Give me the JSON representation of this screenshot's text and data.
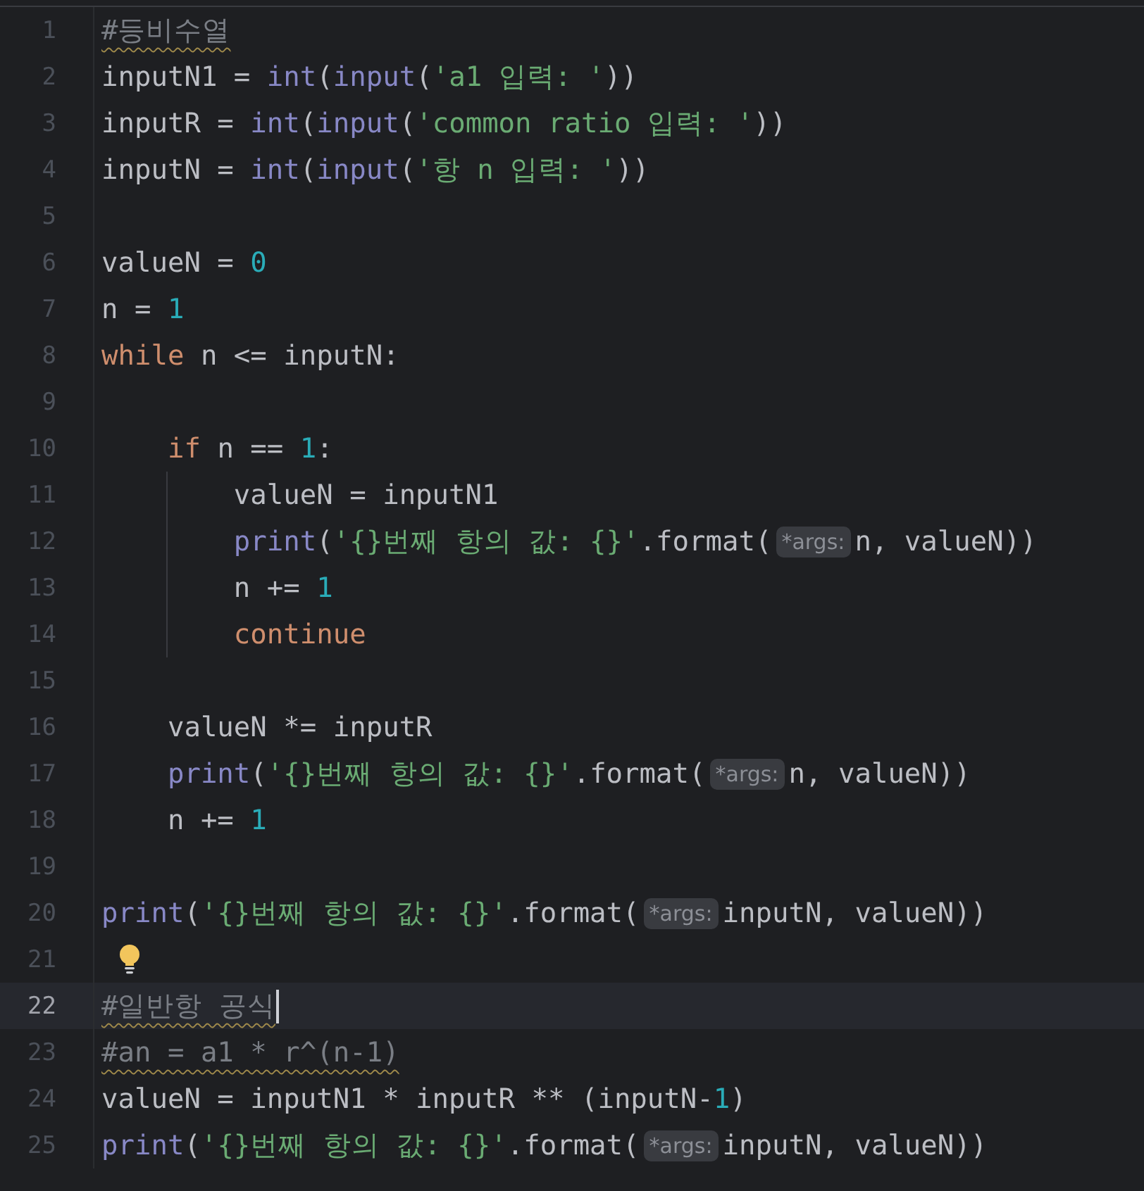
{
  "lines": [
    {
      "number": "1",
      "current": false,
      "tokens": [
        {
          "kind": "comment",
          "text": "#등비수열"
        }
      ]
    },
    {
      "number": "2",
      "current": false,
      "tokens": [
        {
          "kind": "plain",
          "text": "inputN1 = "
        },
        {
          "kind": "builtin",
          "text": "int"
        },
        {
          "kind": "plain",
          "text": "("
        },
        {
          "kind": "builtin",
          "text": "input"
        },
        {
          "kind": "plain",
          "text": "("
        },
        {
          "kind": "str",
          "text": "'a1 입력: '"
        },
        {
          "kind": "plain",
          "text": "))"
        }
      ]
    },
    {
      "number": "3",
      "current": false,
      "tokens": [
        {
          "kind": "plain",
          "text": "inputR = "
        },
        {
          "kind": "builtin",
          "text": "int"
        },
        {
          "kind": "plain",
          "text": "("
        },
        {
          "kind": "builtin",
          "text": "input"
        },
        {
          "kind": "plain",
          "text": "("
        },
        {
          "kind": "str",
          "text": "'common ratio 입력: '"
        },
        {
          "kind": "plain",
          "text": "))"
        }
      ]
    },
    {
      "number": "4",
      "current": false,
      "tokens": [
        {
          "kind": "plain",
          "text": "inputN = "
        },
        {
          "kind": "builtin",
          "text": "int"
        },
        {
          "kind": "plain",
          "text": "("
        },
        {
          "kind": "builtin",
          "text": "input"
        },
        {
          "kind": "plain",
          "text": "("
        },
        {
          "kind": "str",
          "text": "'항 n 입력: '"
        },
        {
          "kind": "plain",
          "text": "))"
        }
      ]
    },
    {
      "number": "5",
      "current": false
    },
    {
      "number": "6",
      "current": false,
      "tokens": [
        {
          "kind": "plain",
          "text": "valueN = "
        },
        {
          "kind": "num",
          "text": "0"
        }
      ]
    },
    {
      "number": "7",
      "current": false,
      "tokens": [
        {
          "kind": "plain",
          "text": "n = "
        },
        {
          "kind": "num",
          "text": "1"
        }
      ]
    },
    {
      "number": "8",
      "current": false,
      "tokens": [
        {
          "kind": "kw",
          "text": "while"
        },
        {
          "kind": "plain",
          "text": " n <= inputN:"
        }
      ]
    },
    {
      "number": "9",
      "current": false
    },
    {
      "number": "10",
      "current": false,
      "tokens": [
        {
          "kind": "kw",
          "text": "    if"
        },
        {
          "kind": "plain",
          "text": " n == "
        },
        {
          "kind": "num",
          "text": "1"
        },
        {
          "kind": "plain",
          "text": ":"
        }
      ]
    },
    {
      "number": "11",
      "current": false,
      "indent_guide": true,
      "tokens": [
        {
          "kind": "plain",
          "text": "        valueN = inputN1"
        }
      ]
    },
    {
      "number": "12",
      "current": false,
      "indent_guide": true,
      "tokens": [
        {
          "kind": "builtin",
          "text": "        print"
        },
        {
          "kind": "plain",
          "text": "("
        },
        {
          "kind": "str",
          "text": "'{}번째 항의 값: {}'"
        },
        {
          "kind": "plain",
          "text": ".format("
        },
        {
          "kind": "hint",
          "text": "*args:"
        },
        {
          "kind": "plain",
          "text": "n, valueN))"
        }
      ]
    },
    {
      "number": "13",
      "current": false,
      "indent_guide": true,
      "tokens": [
        {
          "kind": "plain",
          "text": "        n += "
        },
        {
          "kind": "num",
          "text": "1"
        }
      ]
    },
    {
      "number": "14",
      "current": false,
      "indent_guide": true,
      "tokens": [
        {
          "kind": "kw",
          "text": "        continue"
        }
      ]
    },
    {
      "number": "15",
      "current": false
    },
    {
      "number": "16",
      "current": false,
      "tokens": [
        {
          "kind": "plain",
          "text": "    valueN *= inputR"
        }
      ]
    },
    {
      "number": "17",
      "current": false,
      "tokens": [
        {
          "kind": "builtin",
          "text": "    print"
        },
        {
          "kind": "plain",
          "text": "("
        },
        {
          "kind": "str",
          "text": "'{}번째 항의 값: {}'"
        },
        {
          "kind": "plain",
          "text": ".format("
        },
        {
          "kind": "hint",
          "text": "*args:"
        },
        {
          "kind": "plain",
          "text": "n, valueN))"
        }
      ]
    },
    {
      "number": "18",
      "current": false,
      "tokens": [
        {
          "kind": "plain",
          "text": "    n += "
        },
        {
          "kind": "num",
          "text": "1"
        }
      ]
    },
    {
      "number": "19",
      "current": false
    },
    {
      "number": "20",
      "current": false,
      "tokens": [
        {
          "kind": "builtin",
          "text": "print"
        },
        {
          "kind": "plain",
          "text": "("
        },
        {
          "kind": "str",
          "text": "'{}번째 항의 값: {}'"
        },
        {
          "kind": "plain",
          "text": ".format("
        },
        {
          "kind": "hint",
          "text": "*args:"
        },
        {
          "kind": "plain",
          "text": "inputN, valueN))"
        }
      ]
    },
    {
      "number": "21",
      "current": false,
      "tokens": [
        {
          "kind": "bulb"
        }
      ]
    },
    {
      "number": "22",
      "current": true,
      "tokens": [
        {
          "kind": "comment",
          "text": "#일반항 공식"
        }
      ]
    },
    {
      "number": "23",
      "current": false,
      "tokens": [
        {
          "kind": "comment",
          "text": "#an = a1 * r^(n-1)"
        }
      ]
    },
    {
      "number": "24",
      "current": false,
      "tokens": [
        {
          "kind": "plain",
          "text": "valueN = inputN1 * inputR ** (inputN-"
        },
        {
          "kind": "num",
          "text": "1"
        },
        {
          "kind": "plain",
          "text": ")"
        }
      ]
    },
    {
      "number": "25",
      "current": false,
      "tokens": [
        {
          "kind": "builtin",
          "text": "print"
        },
        {
          "kind": "plain",
          "text": "("
        },
        {
          "kind": "str",
          "text": "'{}번째 항의 값: {}'"
        },
        {
          "kind": "plain",
          "text": ".format("
        },
        {
          "kind": "hint",
          "text": "*args:"
        },
        {
          "kind": "plain",
          "text": "inputN, valueN))"
        }
      ]
    }
  ]
}
